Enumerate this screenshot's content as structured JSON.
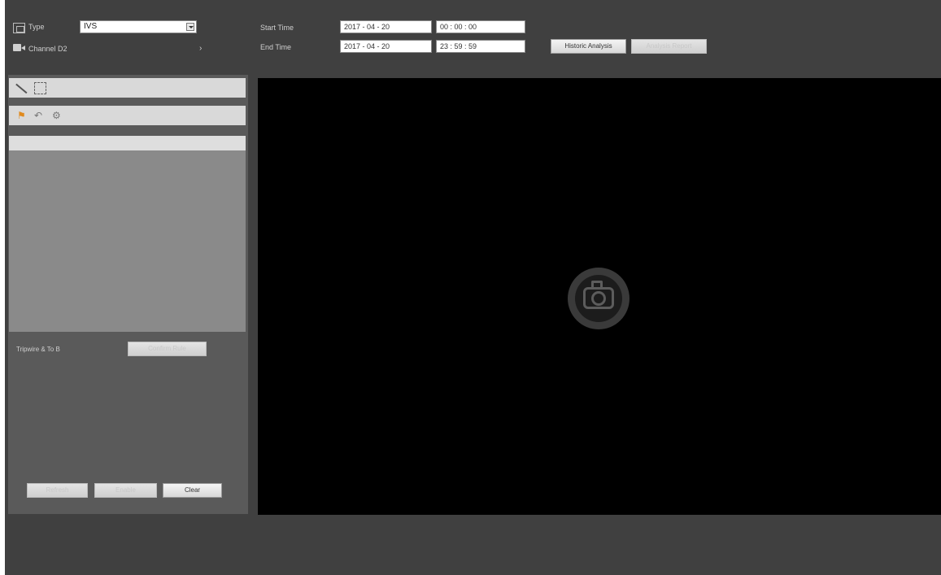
{
  "header": {
    "type_label": "Type",
    "type_value": "IVS",
    "channel_label": "Channel",
    "channel_value": "D2",
    "start_label": "Start Time",
    "end_label": "End Time",
    "start_date": "2017 - 04 - 20",
    "start_time": "00 : 00 : 00",
    "end_date": "2017 - 04 - 20",
    "end_time": "23 : 59 : 59",
    "historic_button": "Historic Analysis",
    "second_button": "Analysis Report"
  },
  "left_panel": {
    "rule_label": "Tripwire & To B",
    "rule_button": "Confirm Rule",
    "bottom_buttons": [
      "Refresh",
      "Enable",
      "Clear"
    ]
  },
  "icons": [
    "type-icon",
    "camera-icon",
    "chevron-right-icon",
    "draw-line-icon",
    "draw-rect-icon",
    "person-add-icon",
    "undo-icon",
    "settings-icon",
    "snapshot-icon"
  ],
  "colors": {
    "background": "#404040",
    "video": "#000000",
    "panel": "#5a5a5a"
  }
}
